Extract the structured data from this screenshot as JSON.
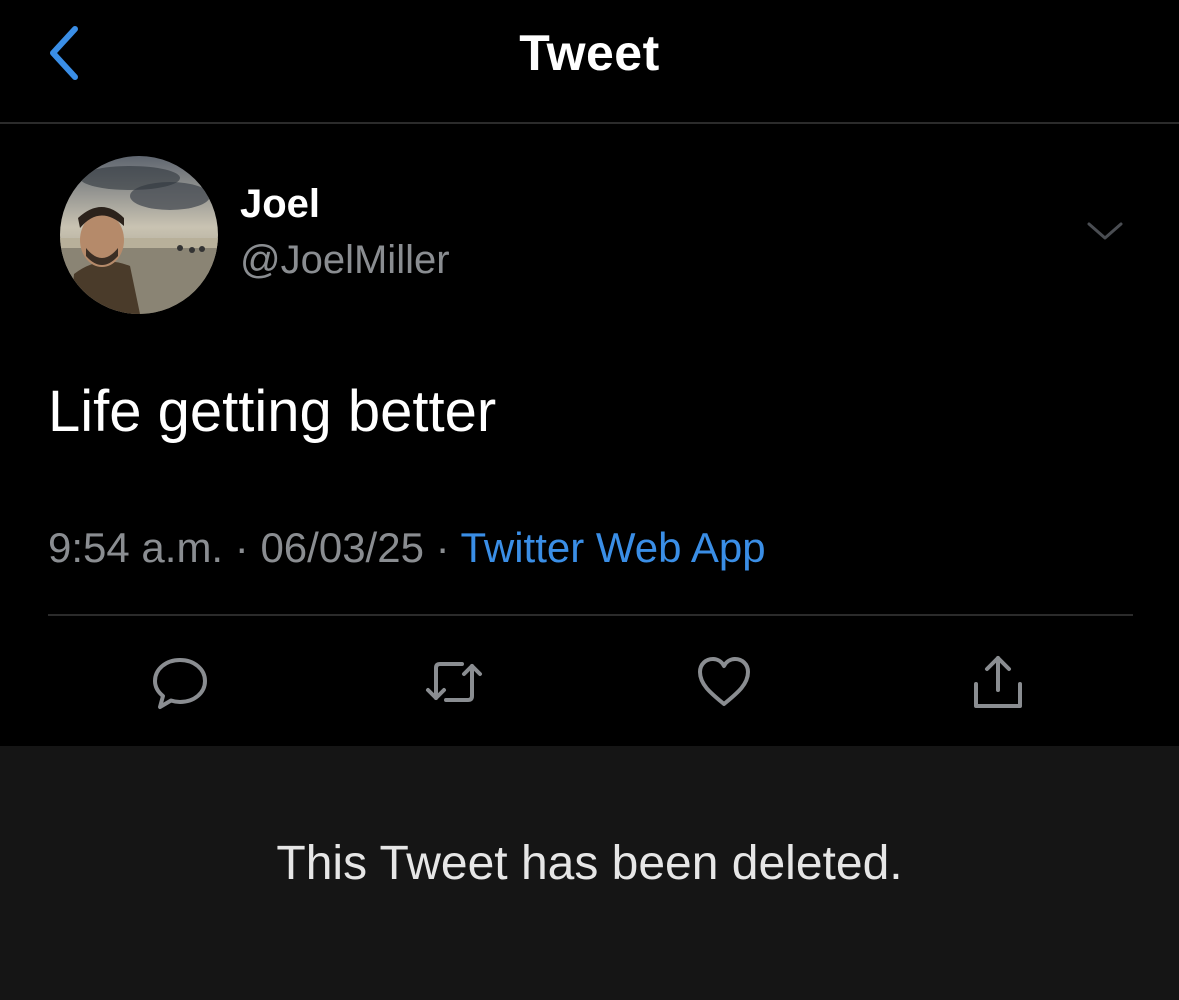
{
  "header": {
    "title": "Tweet",
    "back_icon": "chevron-left-icon"
  },
  "tweet": {
    "author_name": "Joel",
    "author_handle": "@JoelMiller",
    "avatar_icon": "avatar-photo",
    "text": "Life getting better",
    "time": "9:54 a.m.",
    "date": "06/03/25",
    "separator": "·",
    "source": "Twitter Web App"
  },
  "actions": {
    "reply_icon": "reply-icon",
    "retweet_icon": "retweet-icon",
    "like_icon": "heart-icon",
    "share_icon": "share-icon"
  },
  "banner": {
    "message": "This Tweet has been deleted."
  },
  "colors": {
    "background": "#000000",
    "accent_blue": "#3a8ee6",
    "secondary_text": "#8a8d91",
    "banner_background": "#151515"
  }
}
